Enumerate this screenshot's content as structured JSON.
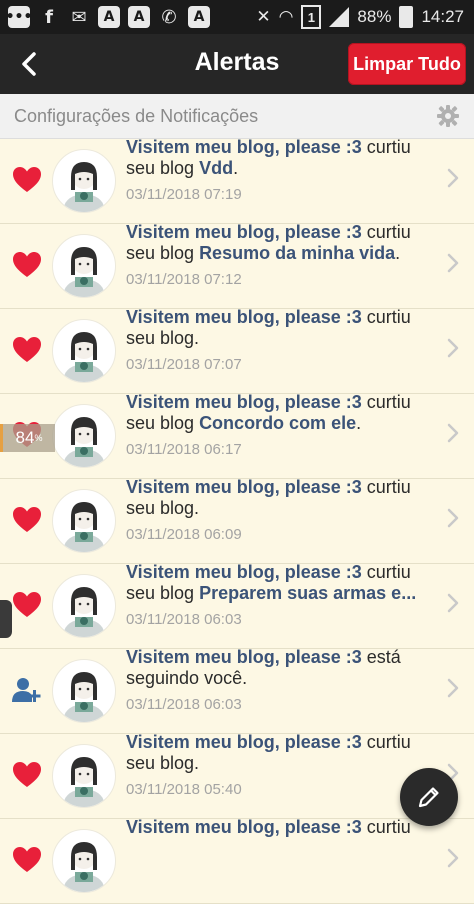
{
  "status_bar": {
    "battery": "88%",
    "time": "14:27",
    "left_icons": [
      "notification-icon",
      "facebook-icon",
      "message-icon",
      "amino-icon",
      "amino-icon",
      "whatsapp-icon",
      "amino-icon"
    ]
  },
  "header": {
    "title": "Alertas",
    "clear_button": "Limpar Tudo",
    "accent": "#e01e2e"
  },
  "settings": {
    "label": "Configurações de Notificações"
  },
  "overlay": {
    "badge": "84"
  },
  "notifications": [
    {
      "type": "like",
      "user": "Visitem meu blog, please :3",
      "action": " curtiu seu blog ",
      "blog": "Vdd",
      "end": ".",
      "time": "03/11/2018 07:19"
    },
    {
      "type": "like",
      "user": "Visitem meu blog, please :3",
      "action": " curtiu seu blog ",
      "blog": "Resumo da minha vida",
      "end": ".",
      "time": "03/11/2018 07:12"
    },
    {
      "type": "like",
      "user": "Visitem meu blog, please :3",
      "action": " curtiu seu blog.",
      "blog": "",
      "end": "",
      "time": "03/11/2018 07:07"
    },
    {
      "type": "like",
      "user": "Visitem meu blog, please :3",
      "action": " curtiu seu blog ",
      "blog": "Concordo com ele",
      "end": ".",
      "time": "03/11/2018 06:17"
    },
    {
      "type": "like",
      "user": "Visitem meu blog, please :3",
      "action": " curtiu seu blog.",
      "blog": "",
      "end": "",
      "time": "03/11/2018 06:09"
    },
    {
      "type": "like",
      "user": "Visitem meu blog, please :3",
      "action": " curtiu seu blog ",
      "blog": "Preparem suas armas e...",
      "end": "",
      "time": "03/11/2018 06:03"
    },
    {
      "type": "follow",
      "user": "Visitem meu blog, please :3",
      "action": " está seguindo você.",
      "blog": "",
      "end": "",
      "time": "03/11/2018 06:03"
    },
    {
      "type": "like",
      "user": "Visitem meu blog, please :3",
      "action": " curtiu seu blog.",
      "blog": "",
      "end": "",
      "time": "03/11/2018 05:40"
    },
    {
      "type": "like",
      "user": "Visitem meu blog, please :3",
      "action": " curtiu",
      "blog": "",
      "end": "",
      "time": ""
    }
  ]
}
